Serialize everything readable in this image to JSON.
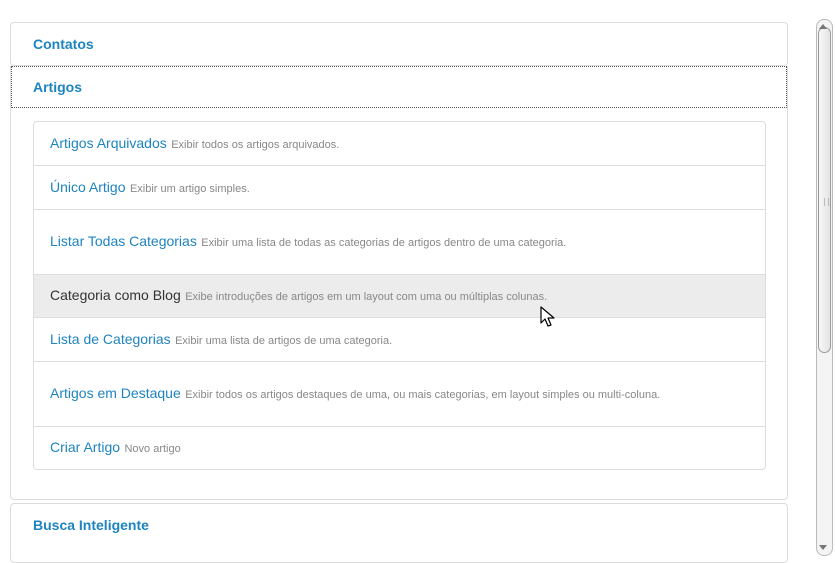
{
  "panels": [
    {
      "title": "Contatos"
    },
    {
      "title": "Artigos"
    },
    {
      "title": "Busca Inteligente"
    }
  ],
  "articles": {
    "items": [
      {
        "title": "Artigos Arquivados",
        "desc": "Exibir todos os artigos arquivados."
      },
      {
        "title": "Único Artigo",
        "desc": "Exibir um artigo simples."
      },
      {
        "title": "Listar Todas Categorias",
        "desc": "Exibir uma lista de todas as categorias de artigos dentro de uma categoria."
      },
      {
        "title": "Categoria como Blog",
        "desc": "Exibe introduções de artigos em um layout com uma ou múltiplas colunas."
      },
      {
        "title": "Lista de Categorias",
        "desc": "Exibir uma lista de artigos de uma categoria."
      },
      {
        "title": "Artigos em Destaque",
        "desc": "Exibir todos os artigos destaques de uma, ou mais categorias, em layout simples ou multi-coluna."
      },
      {
        "title": "Criar Artigo",
        "desc": "Novo artigo"
      }
    ]
  },
  "colors": {
    "link": "#1e84c0",
    "hover_bg": "#ececec"
  }
}
